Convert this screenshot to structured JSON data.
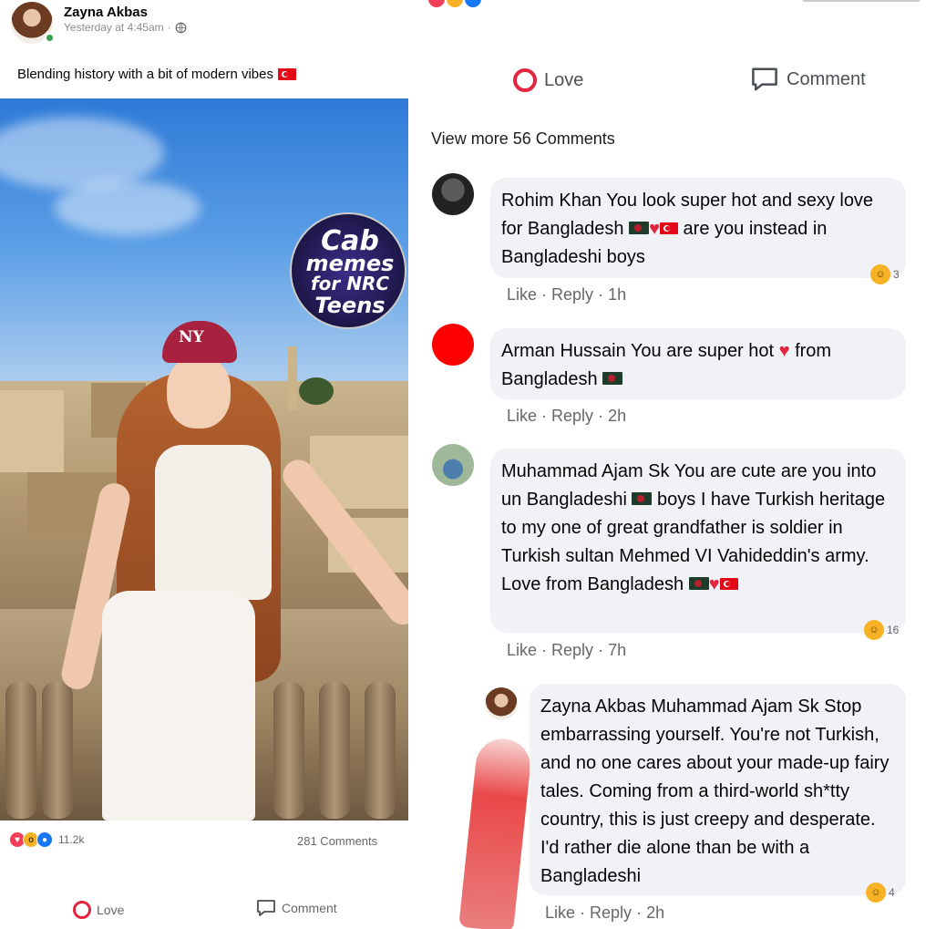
{
  "post": {
    "poster_name": "Zayna Akbas",
    "timestamp": "Yesterday at 4:45am",
    "caption": "Blending history with a bit of modern vibes",
    "image_watermark": [
      "Cab",
      "memes",
      "for NRC",
      "Teens"
    ],
    "cap_logo": "NY",
    "reaction_count": "11.2k",
    "comment_count": "281 Comments",
    "actions": {
      "love": "Love",
      "comment": "Comment"
    }
  },
  "comments_panel": {
    "actions": {
      "love": "Love",
      "comment": "Comment"
    },
    "view_more": "View more 56 Comments",
    "comments": [
      {
        "name": "Rohim Khan",
        "text_a": "You look super hot and sexy love for Bangladesh",
        "text_b": "are you instead in Bangladeshi boys",
        "like": "Like",
        "reply": "Reply",
        "time": "1h",
        "reactions": "3"
      },
      {
        "name": "Arman Hussain",
        "text_a": "You are super hot",
        "text_b": "from Bangladesh",
        "like": "Like",
        "reply": "Reply",
        "time": "2h"
      },
      {
        "name": "Muhammad Ajam Sk",
        "text_a": "You are cute are you into un Bangladeshi",
        "text_b": "boys I have Turkish heritage to my one of great grandfather is soldier in Turkish sultan Mehmed VI Vahideddin's army. Love from Bangladesh",
        "like": "Like",
        "reply": "Reply",
        "time": "7h",
        "reactions": "16"
      },
      {
        "name": "Zayna Akbas",
        "text_a": "Muhammad Ajam Sk Stop embarrassing yourself. You're not Turkish, and no one cares about your made-up fairy tales. Coming from a third-world sh*tty country, this is just creepy and desperate. I'd rather die alone than be with a Bangladeshi",
        "like": "Like",
        "reply": "Reply",
        "time": "2h",
        "reactions": "4"
      }
    ]
  },
  "colors": {
    "love_red": "#e4253f",
    "bubble_bg": "#f0f2f5",
    "meta_gray": "#65676b"
  }
}
